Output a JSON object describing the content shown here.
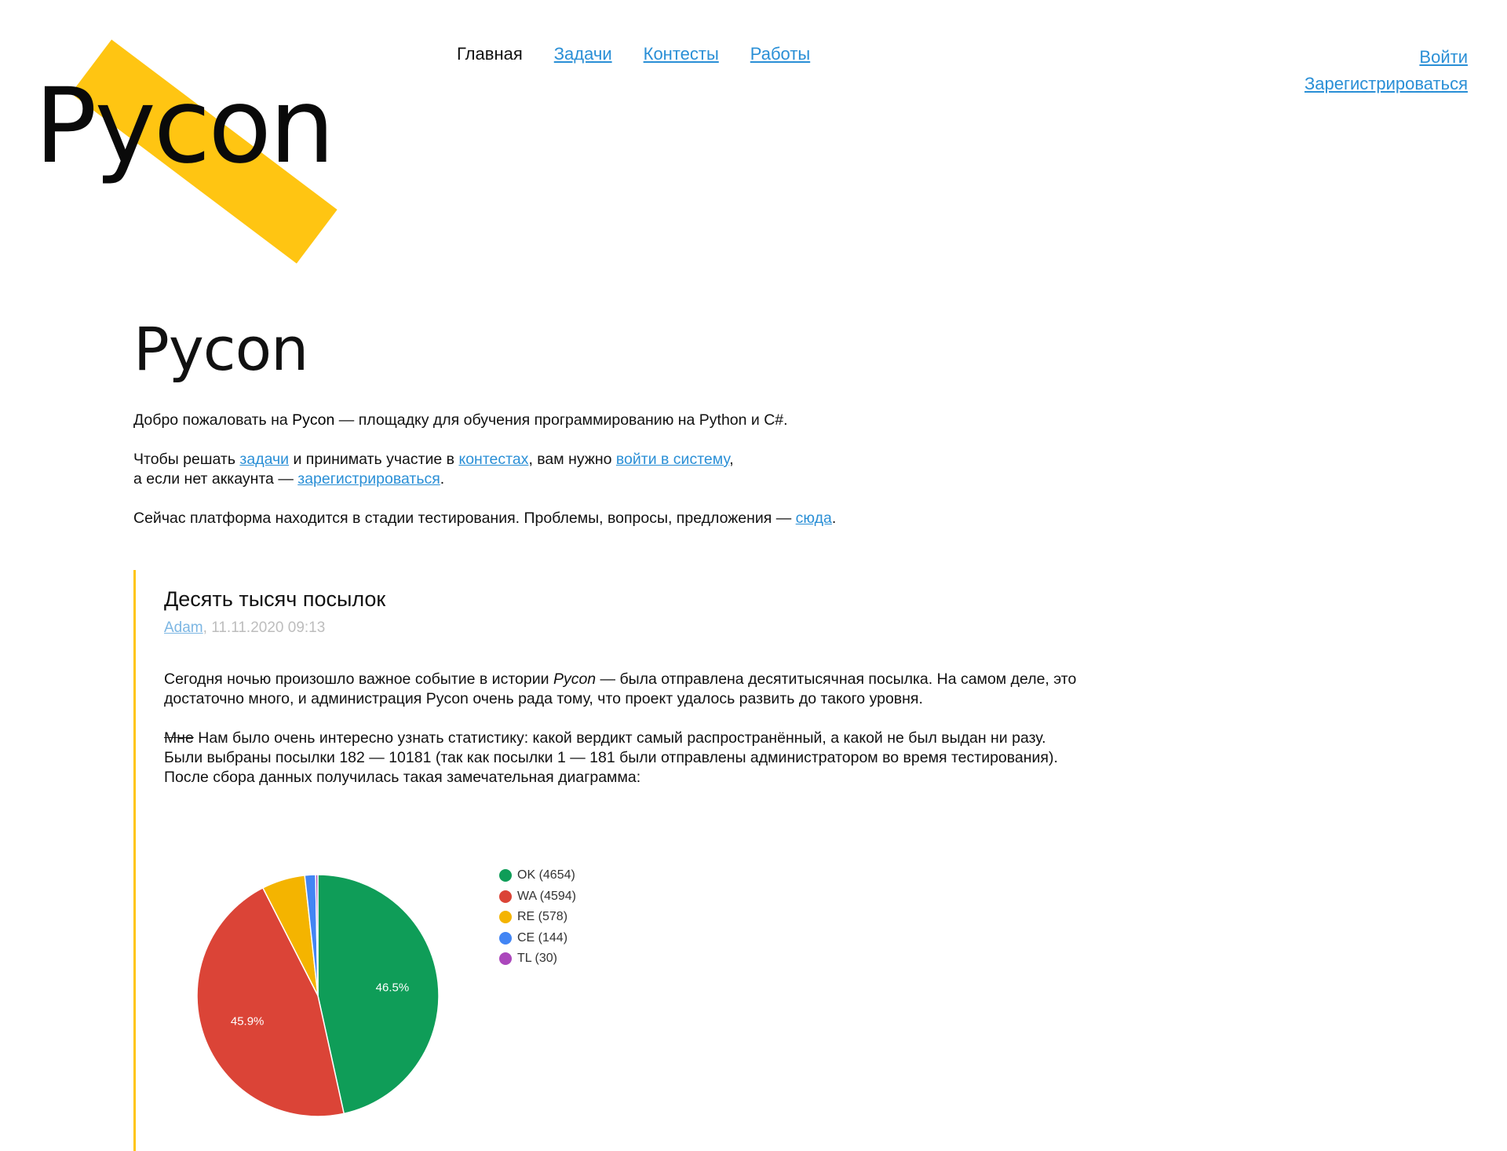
{
  "logo": {
    "text": "Pycon"
  },
  "nav": {
    "items": [
      {
        "label": "Главная",
        "active": true
      },
      {
        "label": "Задачи",
        "active": false
      },
      {
        "label": "Контесты",
        "active": false
      },
      {
        "label": "Работы",
        "active": false
      }
    ]
  },
  "auth": {
    "login": "Войти",
    "register": "Зарегистрироваться"
  },
  "main": {
    "title": "Pycon",
    "welcome": {
      "before": "Добро пожаловать на ",
      "brand": "Pycon",
      "after": " — площадку для обучения программированию на Python и C#."
    },
    "solve": {
      "t1": "Чтобы решать ",
      "l1": "задачи",
      "t2": " и принимать участие в ",
      "l2": "контестах",
      "t3": ", вам нужно ",
      "l3": "войти в систему",
      "t4": ",",
      "t5": "а если нет аккаунта — ",
      "l4": "зарегистрироваться",
      "t6": "."
    },
    "testing": {
      "text": "Сейчас платформа находится в стадии тестирования. Проблемы, вопросы, предложения — ",
      "link": "сюда",
      "end": "."
    }
  },
  "post": {
    "title": "Десять тысяч посылок",
    "author": "Adam",
    "date": ", 11.11.2020 09:13",
    "p1": {
      "before": "Сегодня ночью произошло важное событие в истории ",
      "brand": "Pycon",
      "after": " — была отправлена десятитысячная посылка. На самом деле, это",
      "line2": "достаточно много, и администрация Pycon очень рада тому, что проект удалось развить до такого уровня."
    },
    "p2": {
      "strike": "Мне",
      "line1": " Нам было очень интересно узнать статистику: какой вердикт самый распространённый, а какой не был выдан ни разу.",
      "line2": "Были выбраны посылки 182 — 10181 (так как посылки 1 — 181 были отправлены администратором во время тестирования).",
      "line3": "После сбора данных получилась такая замечательная диаграмма:"
    }
  },
  "chart_data": {
    "type": "pie",
    "series": [
      {
        "name": "OK (4654)",
        "value": 4654,
        "color": "#0f9d58"
      },
      {
        "name": "WA (4594)",
        "value": 4594,
        "color": "#db4437"
      },
      {
        "name": "RE (578)",
        "value": 578,
        "color": "#f4b400"
      },
      {
        "name": "CE (144)",
        "value": 144,
        "color": "#4285f4"
      },
      {
        "name": "TL (30)",
        "value": 30,
        "color": "#ab47bc"
      }
    ],
    "data_labels": [
      "46.5%",
      "45.9%"
    ],
    "legend_position": "right"
  }
}
